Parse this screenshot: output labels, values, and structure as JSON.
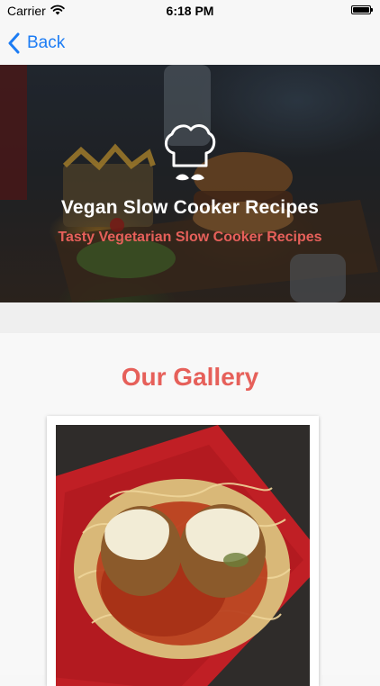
{
  "status_bar": {
    "carrier": "Carrier",
    "time": "6:18 PM"
  },
  "nav": {
    "back_label": "Back"
  },
  "hero": {
    "title": "Vegan Slow Cooker Recipes",
    "subtitle": "Tasty Vegetarian Slow Cooker Recipes"
  },
  "gallery": {
    "heading": "Our Gallery"
  },
  "colors": {
    "accent": "#e6605a",
    "ios_blue": "#1c7cf4",
    "background": "#f7f7f7"
  },
  "icons": {
    "back": "chevron-left-icon",
    "logo": "chef-hat-icon",
    "wifi": "wifi-icon",
    "battery": "battery-icon"
  }
}
